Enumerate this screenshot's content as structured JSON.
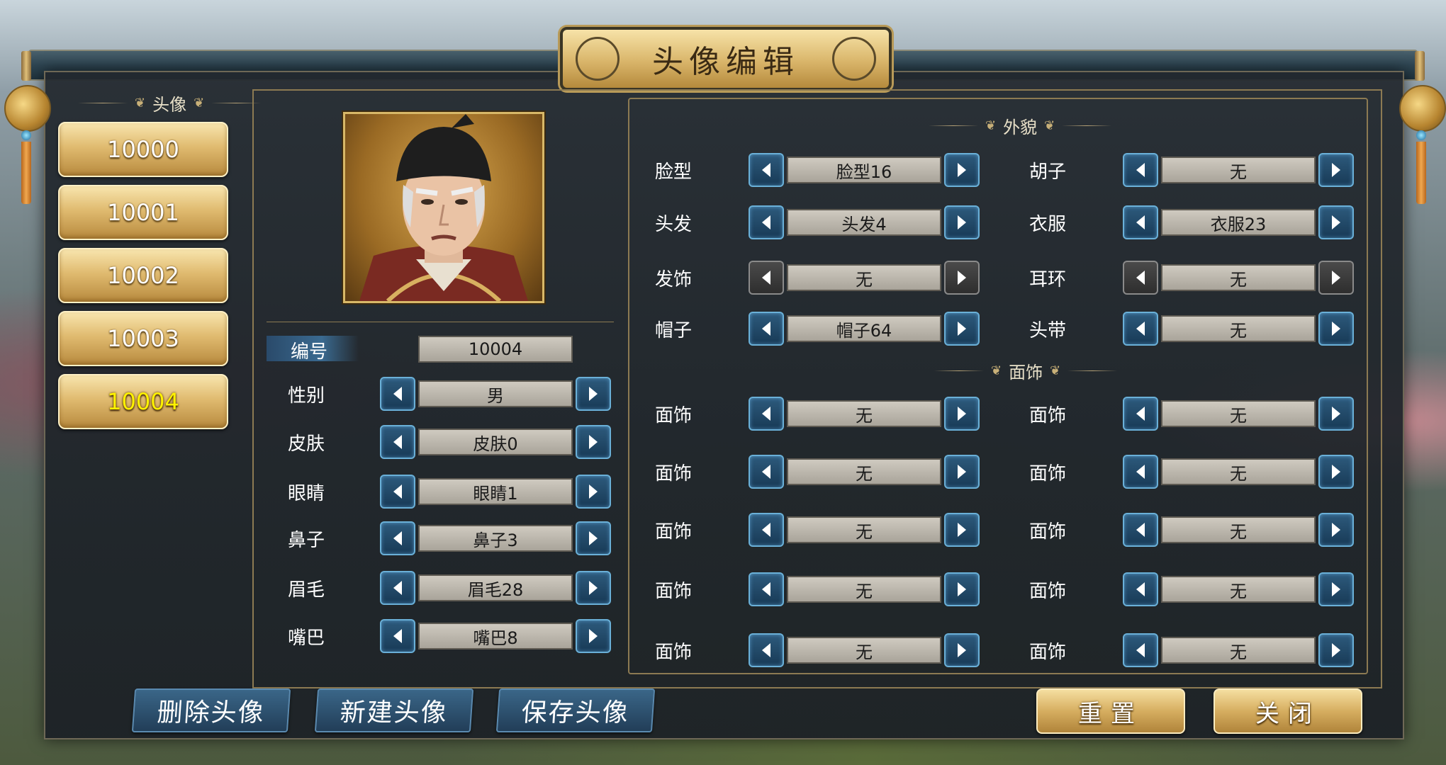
{
  "window": {
    "title": "头像编辑"
  },
  "avatars": {
    "heading": "头像",
    "items": [
      "10000",
      "10001",
      "10002",
      "10003",
      "10004"
    ],
    "selected": "10004"
  },
  "basic": {
    "id_label": "编号",
    "id_value": "10004",
    "rows": [
      {
        "label": "性别",
        "value": "男"
      },
      {
        "label": "皮肤",
        "value": "皮肤0"
      },
      {
        "label": "眼睛",
        "value": "眼睛1"
      },
      {
        "label": "鼻子",
        "value": "鼻子3"
      },
      {
        "label": "眉毛",
        "value": "眉毛28"
      },
      {
        "label": "嘴巴",
        "value": "嘴巴8"
      }
    ]
  },
  "appearance": {
    "heading": "外貌",
    "rows": [
      {
        "label": "脸型",
        "value": "脸型16",
        "enabled": true
      },
      {
        "label": "胡子",
        "value": "无",
        "enabled": true
      },
      {
        "label": "头发",
        "value": "头发4",
        "enabled": true
      },
      {
        "label": "衣服",
        "value": "衣服23",
        "enabled": true
      },
      {
        "label": "发饰",
        "value": "无",
        "enabled": false
      },
      {
        "label": "耳环",
        "value": "无",
        "enabled": false
      },
      {
        "label": "帽子",
        "value": "帽子64",
        "enabled": true
      },
      {
        "label": "头带",
        "value": "无",
        "enabled": true
      }
    ]
  },
  "face_decor": {
    "heading": "面饰",
    "rows": [
      {
        "label": "面饰",
        "value": "无"
      },
      {
        "label": "面饰",
        "value": "无"
      },
      {
        "label": "面饰",
        "value": "无"
      },
      {
        "label": "面饰",
        "value": "无"
      },
      {
        "label": "面饰",
        "value": "无"
      },
      {
        "label": "面饰",
        "value": "无"
      },
      {
        "label": "面饰",
        "value": "无"
      },
      {
        "label": "面饰",
        "value": "无"
      },
      {
        "label": "面饰",
        "value": "无"
      },
      {
        "label": "面饰",
        "value": "无"
      }
    ]
  },
  "buttons": {
    "delete": "删除头像",
    "new": "新建头像",
    "save": "保存头像",
    "reset": "重置",
    "close": "关闭"
  },
  "colors": {
    "accent_gold": "#d9b56a",
    "accent_blue": "#2d5a7c",
    "selected_text": "#fff200"
  }
}
